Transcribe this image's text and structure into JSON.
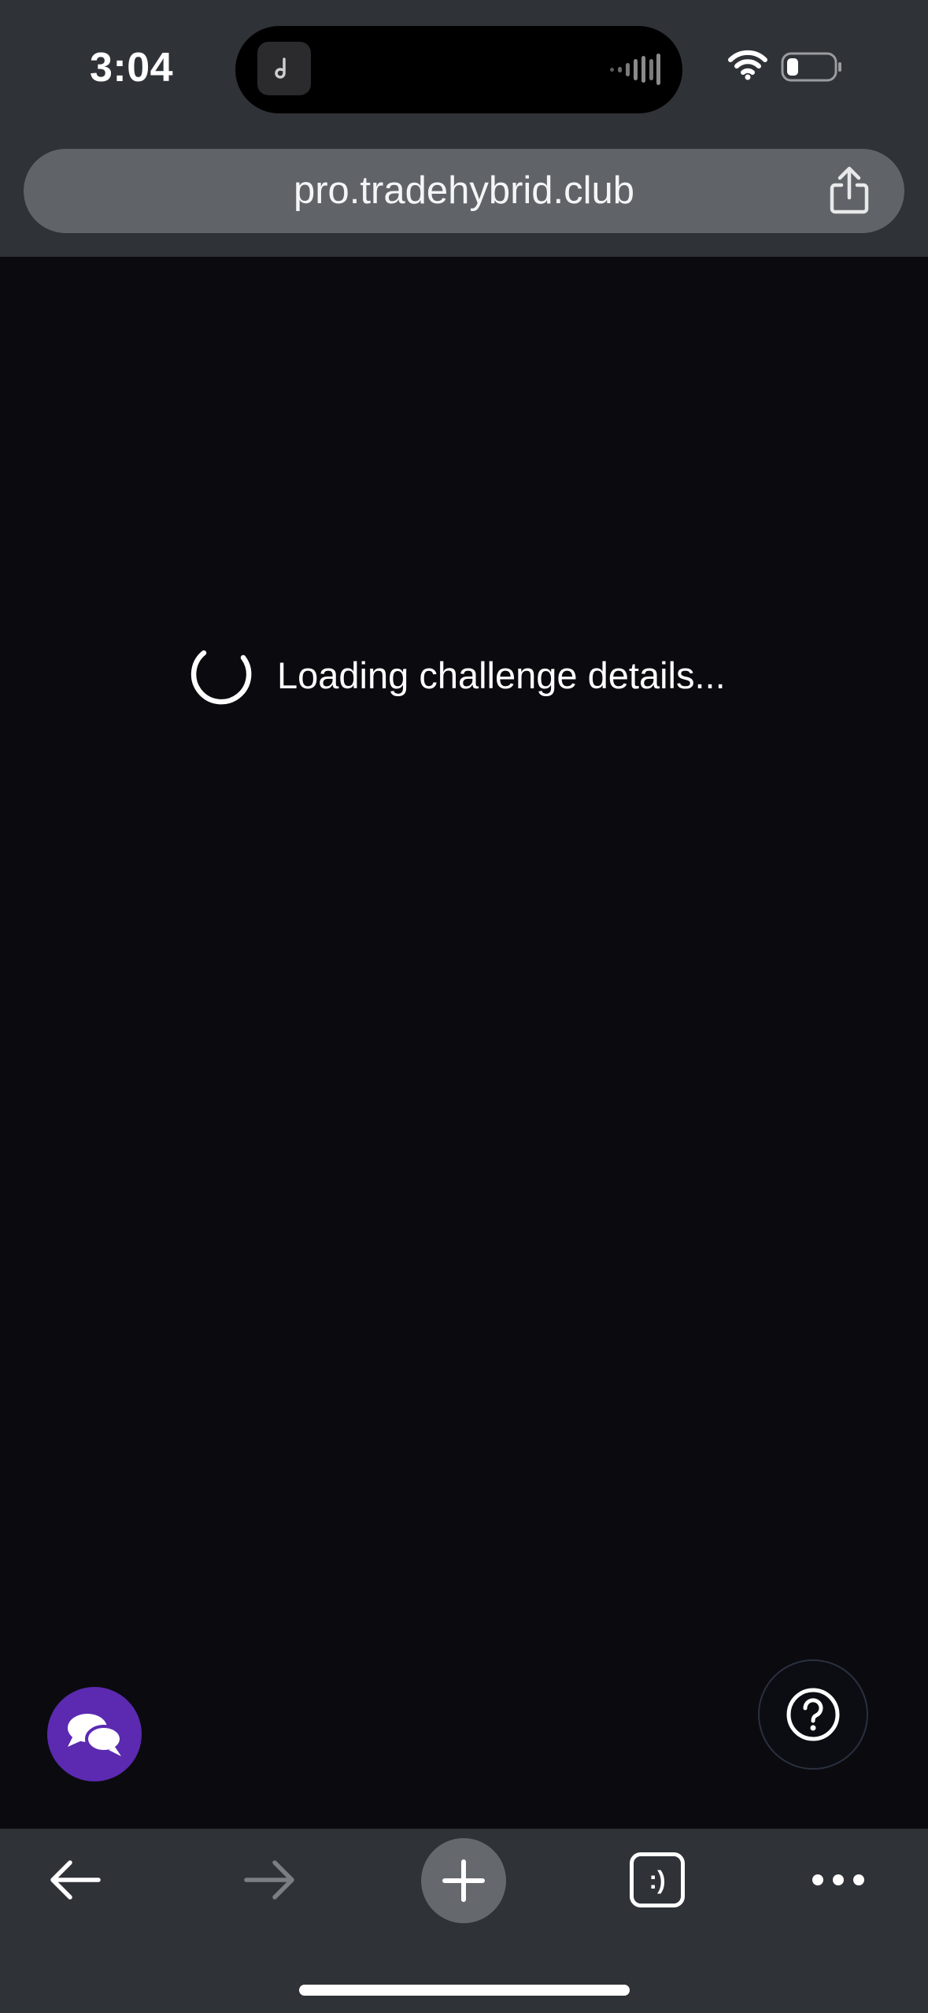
{
  "status_bar": {
    "time": "3:04"
  },
  "browser": {
    "url": "pro.tradehybrid.club",
    "tab_switcher_label": ":)"
  },
  "page": {
    "loading_text": "Loading challenge details..."
  },
  "fabs": {
    "chat_icon": "chat-bubbles-icon",
    "help_icon": "question-circle-icon"
  },
  "colors": {
    "page_background": "#0b0b0f",
    "browser_chrome": "#2f3236",
    "url_bar": "#606468",
    "chat_fab": "#5b2ab0"
  }
}
